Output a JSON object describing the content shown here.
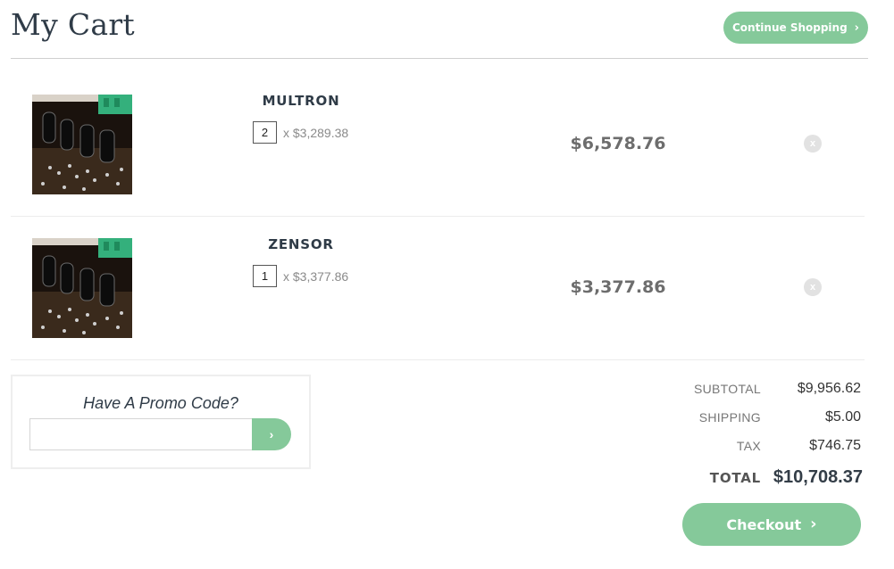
{
  "header": {
    "title": "My Cart",
    "continue_label": "Continue Shopping"
  },
  "items": [
    {
      "name": "MULTRON",
      "qty": "2",
      "unit_price": "x $3,289.38",
      "line_total": "$6,578.76",
      "remove_label": "x"
    },
    {
      "name": "ZENSOR",
      "qty": "1",
      "unit_price": "x $3,377.86",
      "line_total": "$3,377.86",
      "remove_label": "x"
    }
  ],
  "promo": {
    "title": "Have A Promo Code?",
    "input_value": "",
    "apply_label": "›"
  },
  "summary": {
    "subtotal_label": "SUBTOTAL",
    "subtotal_value": "$9,956.62",
    "shipping_label": "SHIPPING",
    "shipping_value": "$5.00",
    "tax_label": "TAX",
    "tax_value": "$746.75",
    "total_label": "TOTAL",
    "total_value": "$10,708.37"
  },
  "checkout_label": "Checkout",
  "colors": {
    "accent": "#85c99a",
    "heading": "#2f3b47",
    "muted": "#777777"
  },
  "icons": {
    "chevron": "chevron-right-icon",
    "remove": "close-icon",
    "product": "circuit-board-image"
  }
}
